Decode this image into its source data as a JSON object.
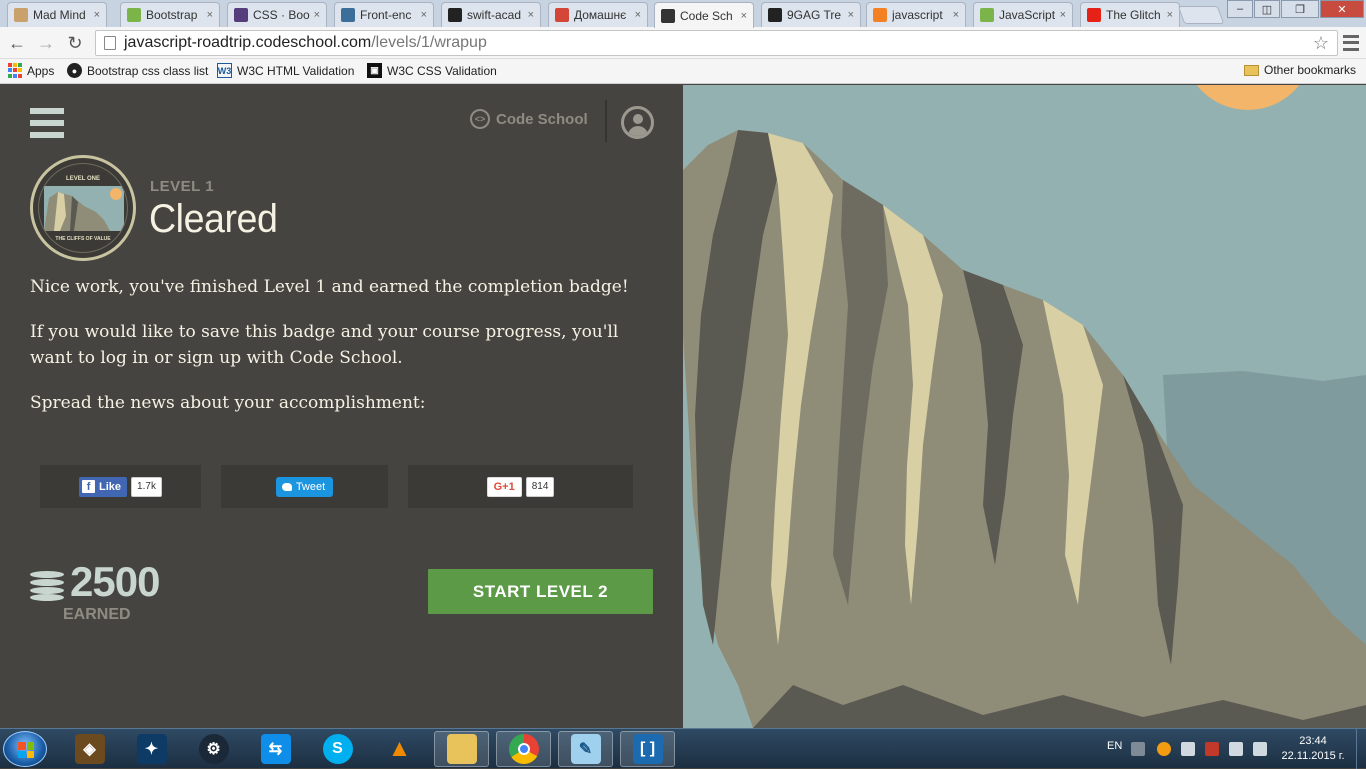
{
  "browser": {
    "tabs": [
      {
        "label": "Mad Mind",
        "color": "#c8a26a"
      },
      {
        "label": "Bootstrap",
        "color": "#7bb54a"
      },
      {
        "label": "CSS · Boo",
        "color": "#563d7c"
      },
      {
        "label": "Front-enc",
        "color": "#3b6e99"
      },
      {
        "label": "swift-acad",
        "color": "#222222"
      },
      {
        "label": "Домашнє",
        "color": "#d44638"
      },
      {
        "label": "Code Sch",
        "color": "#333333",
        "active": true
      },
      {
        "label": "9GAG Tre",
        "color": "#222222"
      },
      {
        "label": "javascript",
        "color": "#f48024"
      },
      {
        "label": "JavaScript",
        "color": "#7bb54a"
      },
      {
        "label": "The Glitch",
        "color": "#e62117"
      }
    ],
    "url_host": "javascript-roadtrip.codeschool.com",
    "url_path": "/levels/1/wrapup",
    "bookmarks": {
      "apps": "Apps",
      "items": [
        "Bootstrap css class list",
        "W3C HTML Validation",
        "W3C CSS Validation"
      ],
      "other": "Other bookmarks"
    }
  },
  "header": {
    "logo_text": "Code School"
  },
  "badge": {
    "top_text": "LEVEL ONE",
    "bottom_text": "THE CLIFFS OF VALUE"
  },
  "level": {
    "label": "LEVEL 1",
    "status": "Cleared"
  },
  "messages": {
    "finished": "Nice work, you've finished Level 1 and earned the completion badge!",
    "save_progress": "If you would like to save this badge and your course progress, you'll want to log in or sign up with Code School.",
    "spread": "Spread the news about your accomplishment:"
  },
  "share": {
    "facebook": {
      "label": "Like",
      "count": "1.7k",
      "glyph": "f"
    },
    "twitter": {
      "label": "Tweet"
    },
    "google": {
      "label": "G+1",
      "count": "814"
    }
  },
  "points": {
    "value": "2500",
    "label": "EARNED"
  },
  "cta": {
    "label": "START LEVEL 2"
  },
  "taskbar": {
    "language": "EN",
    "time": "23:44",
    "date": "22.11.2015 г."
  },
  "colors": {
    "panel_bg": "#454440",
    "sky": "#93b1b0",
    "cta_green": "#5c9a48",
    "sun": "#f2b56a"
  }
}
